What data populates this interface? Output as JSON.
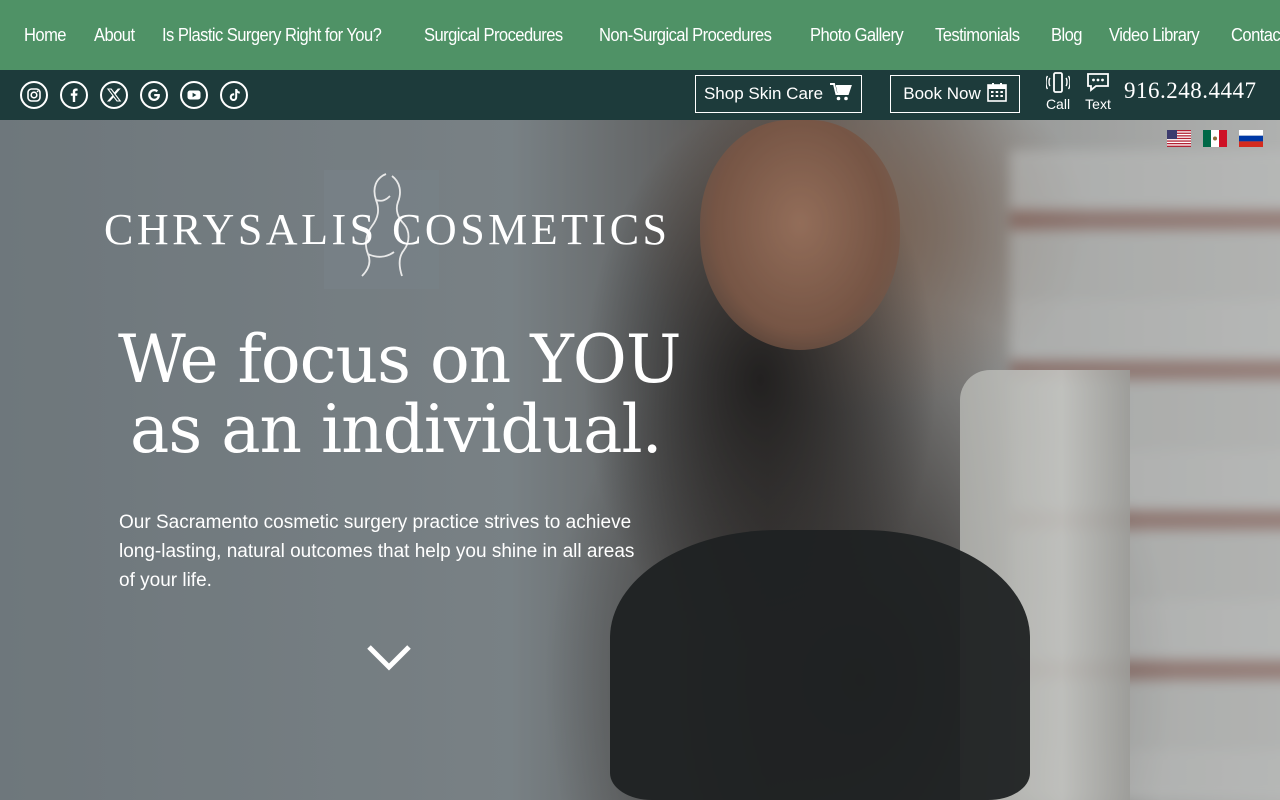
{
  "nav": {
    "items": [
      "Home",
      "About",
      "Is Plastic Surgery Right for You?",
      "Surgical Procedures",
      "Non-Surgical Procedures",
      "Photo Gallery",
      "Testimonials",
      "Blog",
      "Video Library",
      "Contact Us"
    ]
  },
  "utility": {
    "socials": [
      "instagram-icon",
      "facebook-icon",
      "x-icon",
      "google-icon",
      "youtube-icon",
      "tiktok-icon"
    ],
    "shop_label": "Shop Skin Care",
    "book_label": "Book Now",
    "call_label": "Call",
    "text_label": "Text",
    "phone": "916.248.4447"
  },
  "hero": {
    "brand": "CHRYSALIS COSMETICS",
    "headline_line1": "We focus on YOU",
    "headline_line2": "as an individual.",
    "lede": "Our Sacramento cosmetic surgery practice strives to achieve long-lasting, natural outcomes that help you shine in all areas of your life.",
    "languages": [
      "us-flag",
      "mexico-flag",
      "russia-flag"
    ]
  },
  "colors": {
    "nav_bg": "#4f9266",
    "utility_bg": "#1d3b3b",
    "text": "#ffffff"
  }
}
